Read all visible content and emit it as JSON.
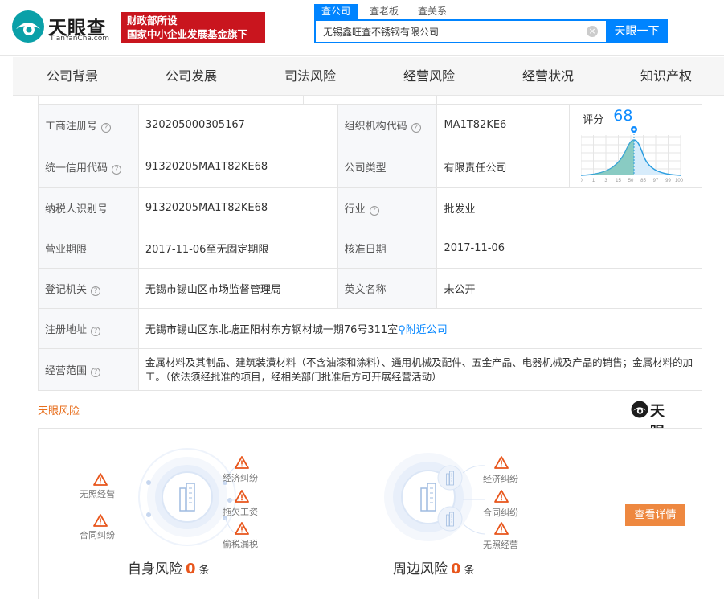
{
  "header": {
    "logo_text": "天眼查",
    "logo_sub": "TianYanCha.com",
    "gov_banner_line1": "财政部所设",
    "gov_banner_line2": "国家中小企业发展基金旗下",
    "search_tabs": [
      "查公司",
      "查老板",
      "查关系"
    ],
    "search_value": "无锡鑫旺查不锈钢有限公司",
    "search_button": "天眼一下",
    "brand_color": "#0084ff"
  },
  "nav": {
    "items": [
      "公司背景",
      "公司发展",
      "司法风险",
      "经营风险",
      "经营状况",
      "知识产权"
    ]
  },
  "info": {
    "reg_no_label": "工商注册号",
    "reg_no": "320205000305167",
    "org_code_label": "组织机构代码",
    "org_code": "MA1T82KE6",
    "credit_code_label": "统一信用代码",
    "credit_code": "91320205MA1T82KE68",
    "company_type_label": "公司类型",
    "company_type": "有限责任公司",
    "taxpayer_label": "纳税人识别号",
    "taxpayer": "91320205MA1T82KE68",
    "industry_label": "行业",
    "industry": "批发业",
    "term_label": "营业期限",
    "term": "2017-11-06至无固定期限",
    "approve_date_label": "核准日期",
    "approve_date": "2017-11-06",
    "authority_label": "登记机关",
    "authority": "无锡市锡山区市场监督管理局",
    "english_name_label": "英文名称",
    "english_name": "未公开",
    "address_label": "注册地址",
    "address": "无锡市锡山区东北塘正阳村东方钢材城一期76号311室",
    "nearby_link": "附近公司",
    "scope_label": "经营范围",
    "scope": "金属材料及其制品、建筑装潢材料（不含油漆和涂料）、通用机械及配件、五金产品、电器机械及产品的销售；金属材料的加工。（依法须经批准的项目，经相关部门批准后方可开展经营活动）"
  },
  "score": {
    "label": "评分",
    "value": "68",
    "axis_ticks": [
      "0",
      "1",
      "3",
      "15",
      "50",
      "85",
      "97",
      "99",
      "100"
    ]
  },
  "risk": {
    "section_title": "天眼风险",
    "logo_text": "天眼查",
    "self_items": [
      "无照经营",
      "合同纠纷",
      "经济纠纷",
      "拖欠工资",
      "偷税漏税"
    ],
    "self_label": "自身风险",
    "self_count": "0",
    "around_items": [
      "经济纠纷",
      "合同纠纷",
      "无照经营"
    ],
    "around_label": "周边风险",
    "around_count": "0",
    "unit": "条",
    "detail_button": "查看详情",
    "warning_color": "#e8561c"
  }
}
